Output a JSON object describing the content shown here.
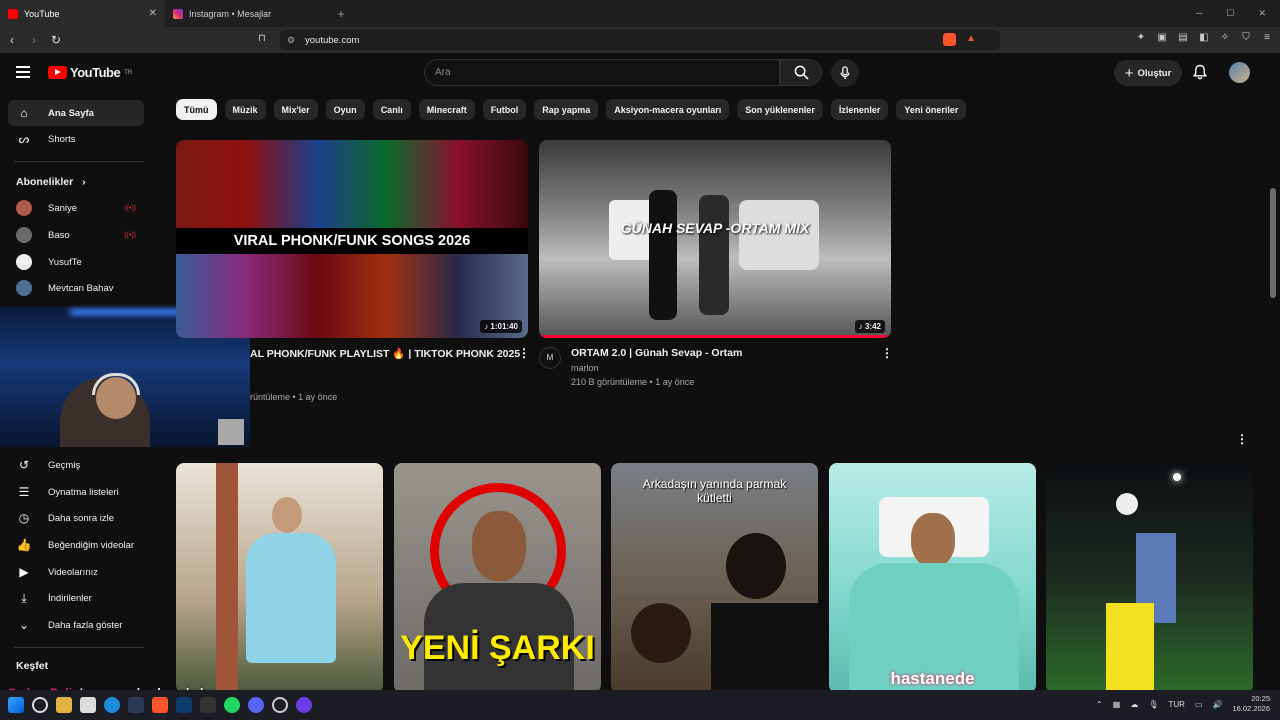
{
  "browser": {
    "tabs": [
      {
        "label": "YouTube",
        "active": true
      },
      {
        "label": "Instagram • Mesajlar",
        "active": false
      }
    ],
    "new_tab": "+",
    "url": "youtube.com"
  },
  "youtube": {
    "logo_text": "YouTube",
    "logo_region": "TR",
    "search_placeholder": "Ara",
    "create_label": "Oluştur"
  },
  "sidebar": {
    "home": "Ana Sayfa",
    "shorts": "Shorts",
    "subscriptions_header": "Abonelikler",
    "subscriptions": [
      {
        "name": "Saniye",
        "live": true,
        "color": "#b05a4c"
      },
      {
        "name": "Baso",
        "live": true,
        "color": "#6b6b6b"
      },
      {
        "name": "YusufTe",
        "live": false,
        "color": "#eeeeee"
      },
      {
        "name": "Mevtcan Bahav",
        "live": false,
        "color": "#4f6f8f"
      }
    ],
    "you_items": [
      {
        "label": "Geçmiş",
        "icon": "history-icon"
      },
      {
        "label": "Oynatma listeleri",
        "icon": "playlist-icon"
      },
      {
        "label": "Daha sonra izle",
        "icon": "clock-icon"
      },
      {
        "label": "Beğendiğim videolar",
        "icon": "thumbs-up-icon"
      },
      {
        "label": "Videolarınız",
        "icon": "video-icon"
      },
      {
        "label": "İndirilenler",
        "icon": "download-icon"
      },
      {
        "label": "Daha fazla göster",
        "icon": "chevron-down-icon"
      }
    ],
    "explore_header": "Keşfet"
  },
  "chips": [
    "Tümü",
    "Müzik",
    "Mix'ler",
    "Oyun",
    "Canlı",
    "Minecraft",
    "Futbol",
    "Rap yapma",
    "Aksiyon-macera oyunları",
    "Son yüklenenler",
    "İzlenenler",
    "Yeni öneriler"
  ],
  "videos": [
    {
      "thumb_text": "VIRAL PHONK/FUNK SONGS 2026",
      "duration": "1:01:40",
      "title": "AL PHONK/FUNK PLAYLIST 🔥 | TIKTOK PHONK 2025",
      "meta": "rüntüleme • 1 ay önce"
    },
    {
      "thumb_text": "GÜNAH SEVAP -ORTAM MIX",
      "duration": "3:42",
      "title": "ORTAM 2.0 | Günah Sevap - Ortam",
      "channel": "marlon",
      "channel_avatar": "M",
      "meta": "210 B görüntüleme • 1 ay önce"
    }
  ],
  "shorts": [
    {
      "overlay": "",
      "color": "#b8a48a"
    },
    {
      "overlay": "YENİ ŞARKI",
      "color": "#6e6a66"
    },
    {
      "overlay": "Arkadaşın yanında parmak kütletti",
      "color": "#5e4a38"
    },
    {
      "overlay": "hastanede",
      "color": "#7ed6cf"
    },
    {
      "overlay": "",
      "color": "#1b4a22"
    }
  ],
  "chat_overlay": {
    "name": "SadecePoli",
    "message": ": !recep neden ben dede"
  },
  "taskbar": {
    "language": "TUR",
    "time": "20:25",
    "date": "16.02.2026"
  }
}
